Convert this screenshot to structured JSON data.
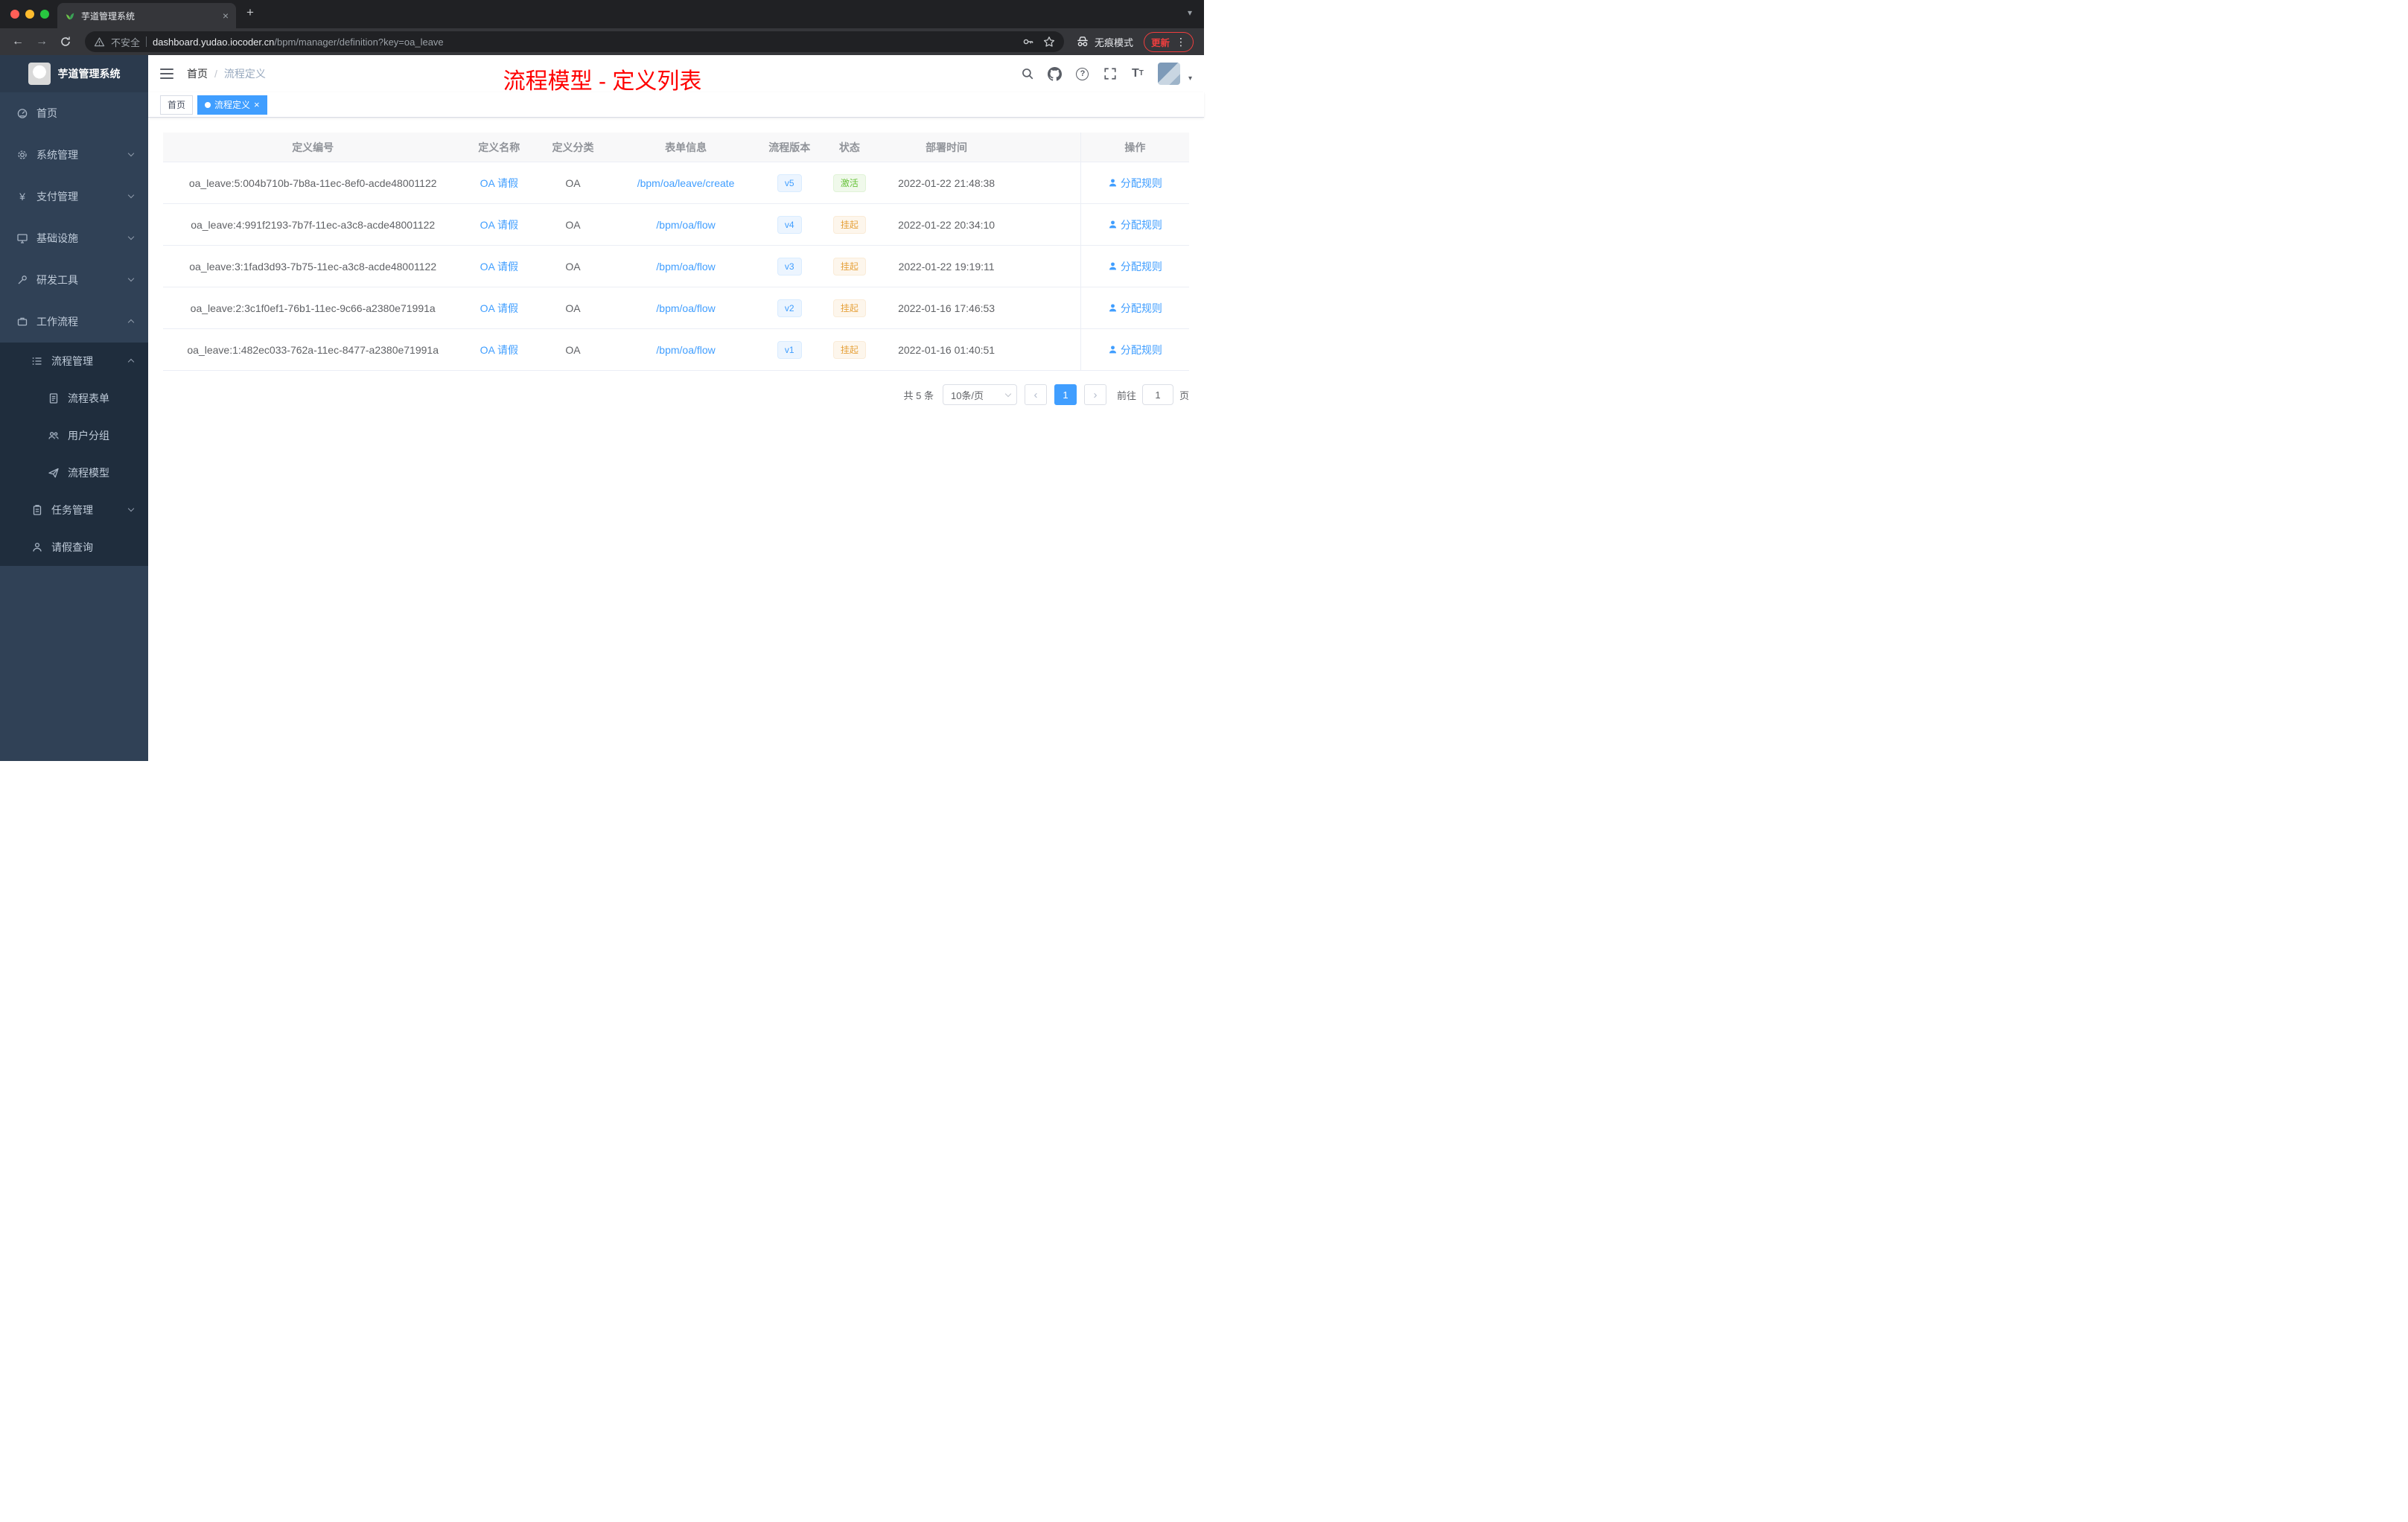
{
  "colors": {
    "accent": "#409eff",
    "success": "#67c23a",
    "warning": "#e6a23c",
    "annotation_red": "#ff0000",
    "sidebar_bg": "#304156",
    "submenu_bg": "#1f2d3d",
    "tag_active_bg": "#409eff"
  },
  "glyphs": {
    "plus": "+",
    "close": "×",
    "caret": "▾",
    "prev": "‹",
    "next": "›",
    "dots": "⋮",
    "back": "←",
    "forward": "→",
    "slash": "/",
    "question": "?",
    "yen": "¥",
    "t_large": "T",
    "t_small": "T"
  },
  "browser": {
    "tab_title": "芋道管理系统",
    "security_label": "不安全",
    "url_host": "dashboard.yudao.iocoder.cn",
    "url_path": "/bpm/manager/definition?key=oa_leave",
    "incognito_label": "无痕模式",
    "update_label": "更新"
  },
  "sidebar": {
    "logo_title": "芋道管理系统",
    "items": [
      {
        "label": "首页"
      },
      {
        "label": "系统管理"
      },
      {
        "label": "支付管理"
      },
      {
        "label": "基础设施"
      },
      {
        "label": "研发工具"
      },
      {
        "label": "工作流程"
      },
      {
        "label": "流程管理"
      },
      {
        "label": "流程表单"
      },
      {
        "label": "用户分组"
      },
      {
        "label": "流程模型"
      },
      {
        "label": "任务管理"
      },
      {
        "label": "请假查询"
      }
    ]
  },
  "header": {
    "breadcrumb_home": "首页",
    "breadcrumb_current": "流程定义",
    "annotation": "流程模型 - 定义列表"
  },
  "tags": {
    "home": "首页",
    "active": "流程定义"
  },
  "table": {
    "columns": [
      "定义编号",
      "定义名称",
      "定义分类",
      "表单信息",
      "流程版本",
      "状态",
      "部署时间",
      "操作"
    ],
    "rows": [
      {
        "id": "oa_leave:5:004b710b-7b8a-11ec-8ef0-acde48001122",
        "name": "OA 请假",
        "category": "OA",
        "form": "/bpm/oa/leave/create",
        "version": "v5",
        "status": "激活",
        "time": "2022-01-22 21:48:38",
        "action": "分配规则"
      },
      {
        "id": "oa_leave:4:991f2193-7b7f-11ec-a3c8-acde48001122",
        "name": "OA 请假",
        "category": "OA",
        "form": "/bpm/oa/flow",
        "version": "v4",
        "status": "挂起",
        "time": "2022-01-22 20:34:10",
        "action": "分配规则"
      },
      {
        "id": "oa_leave:3:1fad3d93-7b75-11ec-a3c8-acde48001122",
        "name": "OA 请假",
        "category": "OA",
        "form": "/bpm/oa/flow",
        "version": "v3",
        "status": "挂起",
        "time": "2022-01-22 19:19:11",
        "action": "分配规则"
      },
      {
        "id": "oa_leave:2:3c1f0ef1-76b1-11ec-9c66-a2380e71991a",
        "name": "OA 请假",
        "category": "OA",
        "form": "/bpm/oa/flow",
        "version": "v2",
        "status": "挂起",
        "time": "2022-01-16 17:46:53",
        "action": "分配规则"
      },
      {
        "id": "oa_leave:1:482ec033-762a-11ec-8477-a2380e71991a",
        "name": "OA 请假",
        "category": "OA",
        "form": "/bpm/oa/flow",
        "version": "v1",
        "status": "挂起",
        "time": "2022-01-16 01:40:51",
        "action": "分配规则"
      }
    ]
  },
  "pagination": {
    "total": "共 5 条",
    "page_size": "10条/页",
    "current_page": "1",
    "goto_label": "前往",
    "goto_value": "1",
    "page_unit": "页"
  }
}
